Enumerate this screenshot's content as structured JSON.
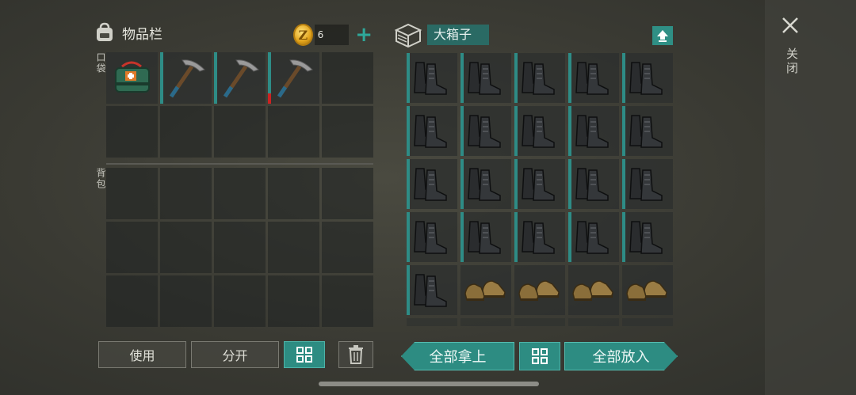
{
  "inventory": {
    "title": "物品栏",
    "pocket_label": "口袋",
    "backpack_label": "背包",
    "coins": "6",
    "coin_symbol": "Z",
    "pocket_items": [
      "medkit-bag-icon",
      "pickaxe-icon",
      "pickaxe-icon",
      "pickaxe-icon",
      "",
      "",
      "",
      "",
      "",
      ""
    ],
    "backpack_items": 15
  },
  "chest": {
    "name": "大箱子",
    "items": [
      "boots-black-icon",
      "boots-black-icon",
      "boots-black-icon",
      "boots-black-icon",
      "boots-black-icon",
      "boots-black-icon",
      "boots-black-icon",
      "boots-black-icon",
      "boots-black-icon",
      "boots-black-icon",
      "boots-black-icon",
      "boots-black-icon",
      "boots-black-icon",
      "boots-black-icon",
      "boots-black-icon",
      "boots-black-icon",
      "boots-black-icon",
      "boots-black-icon",
      "boots-black-icon",
      "boots-black-icon",
      "boots-black-icon",
      "shoes-brown-icon",
      "shoes-brown-icon",
      "shoes-brown-icon",
      "shoes-brown-icon"
    ]
  },
  "buttons": {
    "use": "使用",
    "split": "分开",
    "take_all": "全部拿上",
    "put_all": "全部放入"
  },
  "close": {
    "label": "关闭"
  },
  "colors": {
    "accent": "#2d8c82",
    "coin": "#e1a21a"
  }
}
